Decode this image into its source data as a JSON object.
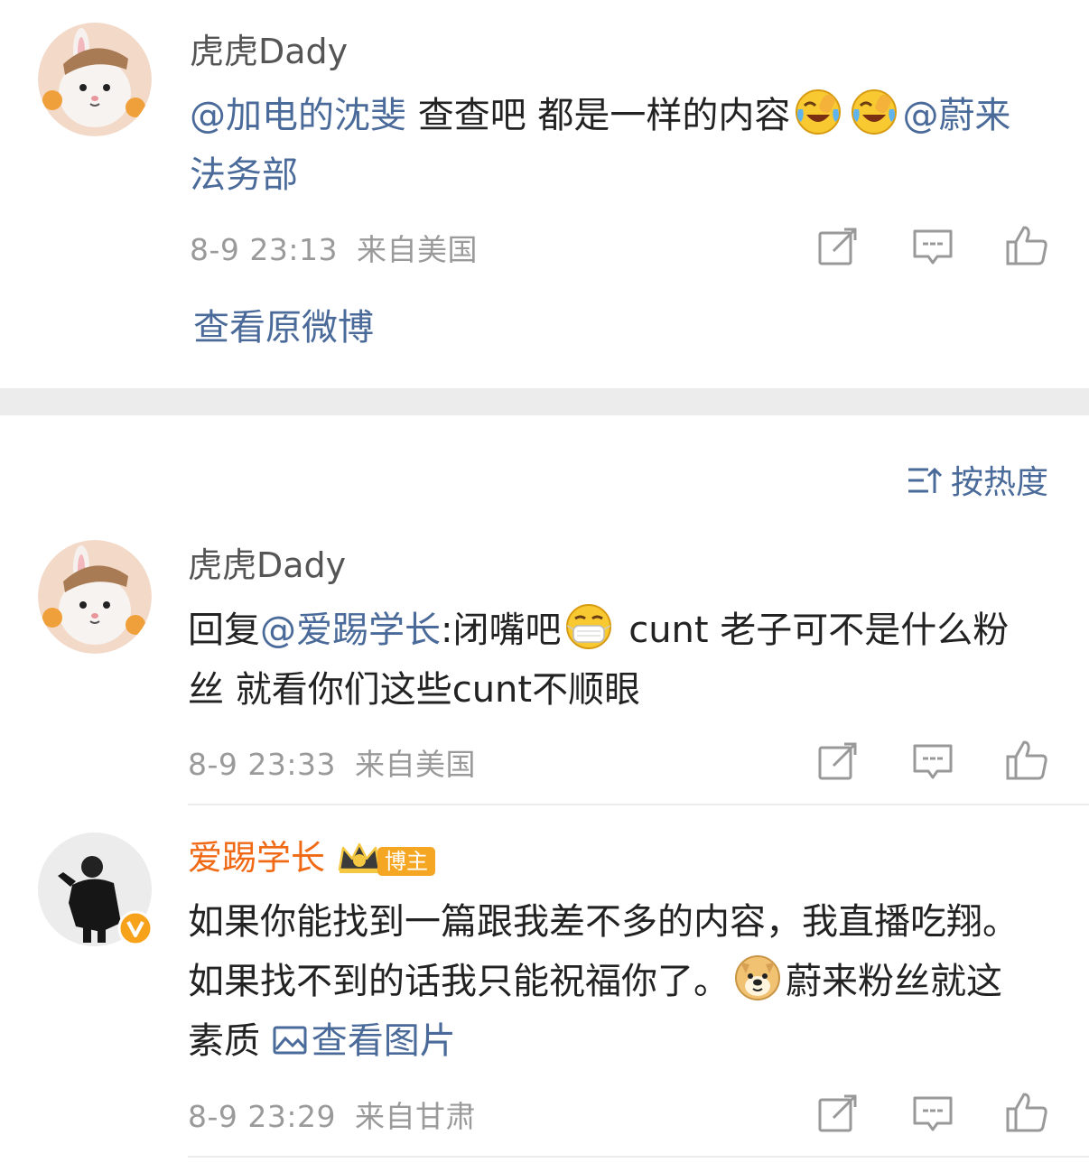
{
  "comments": [
    {
      "user": "虎虎Dady",
      "mention1": "@加电的沈斐",
      "text": " 查查吧 都是一样的内容",
      "mention2": "@蔚来法务部",
      "time": "8-9 23:13",
      "location": "来自美国",
      "view_original": "查看原微博"
    },
    {
      "user": "虎虎Dady",
      "reply_prefix": "回复",
      "mention": "@爱踢学长",
      "text_a": ":闭嘴吧",
      "text_b": " cunt 老子可不是什么粉丝 就看你们这些cunt不顺眼",
      "time": "8-9 23:33",
      "location": "来自美国"
    },
    {
      "user": "爱踢学长",
      "badge": "博主",
      "text_a": "如果你能找到一篇跟我差不多的内容，我直播吃翔。如果找不到的话我只能祝福你了。",
      "text_b": "蔚来粉丝就这素质 ",
      "view_image": "查看图片",
      "time": "8-9 23:29",
      "location": "来自甘肃"
    }
  ],
  "sort_label": "按热度",
  "icons": {
    "share": "share-icon",
    "comment": "comment-icon",
    "like": "like-icon",
    "sort": "sort-icon",
    "image": "image-icon"
  },
  "colors": {
    "link": "#4a6a9a",
    "username": "#555555",
    "author_name": "#f06a16",
    "meta": "#9a9a9a",
    "badge": "#f5a623"
  }
}
